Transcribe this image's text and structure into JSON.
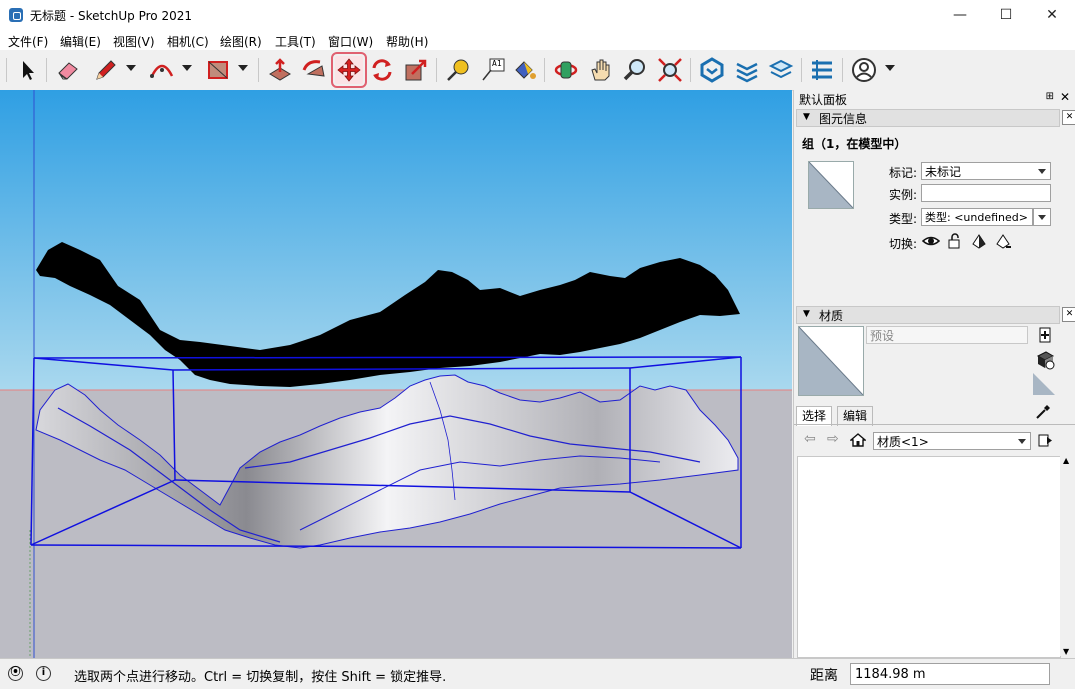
{
  "window": {
    "title": "无标题 - SketchUp Pro 2021",
    "minimize": "—",
    "maximize": "☐",
    "close": "✕"
  },
  "menu": [
    "文件(F)",
    "编辑(E)",
    "视图(V)",
    "相机(C)",
    "绘图(R)",
    "工具(T)",
    "窗口(W)",
    "帮助(H)"
  ],
  "toolbar": {
    "icons": [
      "select-icon",
      "eraser-icon",
      "pencil-icon",
      "arc-icon",
      "shape-icon",
      "push-pull-icon",
      "follow-me-icon",
      "move-icon",
      "rotate-icon",
      "scale-icon",
      "tape-measure-icon",
      "text-icon",
      "paint-bucket-icon",
      "orbit-icon",
      "pan-icon",
      "zoom-icon",
      "zoom-extents-icon",
      "warehouse-icon",
      "extension-warehouse-icon",
      "layout-icon",
      "extension-manager-icon",
      "account-icon"
    ],
    "selected": "move-icon",
    "text_tool_label": "A1",
    "selected_color": "#e06070"
  },
  "panel": {
    "title": "默认面板",
    "pin": "⊞",
    "close": "✕",
    "entity_section": "图元信息",
    "entity_title": "组（1，在模型中）",
    "tag_label": "标记:",
    "tag_value": "未标记",
    "instance_label": "实例:",
    "instance_value": "",
    "type_label": "类型:",
    "type_value": "类型: <undefined>",
    "toggle_label": "切换:",
    "material_section": "材质",
    "material_placeholder": "预设",
    "tab_select": "选择",
    "tab_edit": "编辑",
    "material_dropdown": "材质<1>"
  },
  "status": {
    "message": "选取两个点进行移动。Ctrl = 切换复制，按住 Shift = 锁定推导.",
    "measure_label": "距离",
    "measure_value": "1184.98 m"
  },
  "colors": {
    "sky_top": "#2f9fe3",
    "sky_bottom": "#a9d8ee",
    "ground": "#bcbcc4",
    "selection_box": "#1010e0",
    "terrain_dark": "#000000"
  }
}
